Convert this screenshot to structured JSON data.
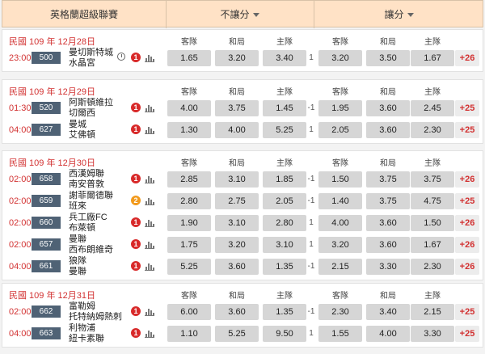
{
  "header": {
    "league": "英格蘭超級聯賽",
    "non_handicap": "不讓分",
    "handicap": "讓分"
  },
  "col_labels": [
    "客隊",
    "和局",
    "主隊",
    "客隊",
    "和局",
    "主隊"
  ],
  "colors": {
    "date_red": "#d23131",
    "code_bg": "#4f6275",
    "header_bg": "#ffe2c6",
    "badge_red": "#d82a2a",
    "badge_orange": "#f29a1c"
  },
  "sections": [
    {
      "date": "民國 109 年 12月28日",
      "matches": [
        {
          "time": "23:00",
          "code": "500",
          "away": "曼切斯特城",
          "home": "水晶宮",
          "clock": true,
          "badge": "1",
          "badge_color": "red",
          "o1": "1.65",
          "o2": "3.20",
          "o3": "3.40",
          "hcap": "1",
          "h1": "3.20",
          "h2": "3.50",
          "h3": "1.67",
          "more": "+26"
        }
      ]
    },
    {
      "date": "民國 109 年 12月29日",
      "matches": [
        {
          "time": "01:30",
          "code": "520",
          "away": "阿斯頓維拉",
          "home": "切爾西",
          "clock": false,
          "badge": "1",
          "badge_color": "red",
          "o1": "4.00",
          "o2": "3.75",
          "o3": "1.45",
          "hcap": "-1",
          "h1": "1.95",
          "h2": "3.60",
          "h3": "2.45",
          "more": "+25"
        },
        {
          "time": "04:00",
          "code": "627",
          "away": "曼城",
          "home": "艾佛頓",
          "clock": false,
          "badge": "1",
          "badge_color": "red",
          "o1": "1.30",
          "o2": "4.00",
          "o3": "5.25",
          "hcap": "1",
          "h1": "2.05",
          "h2": "3.60",
          "h3": "2.30",
          "more": "+25"
        }
      ]
    },
    {
      "date": "民國 109 年 12月30日",
      "matches": [
        {
          "time": "02:00",
          "code": "658",
          "away": "西漢姆聯",
          "home": "南安普敦",
          "clock": false,
          "badge": "1",
          "badge_color": "red",
          "o1": "2.85",
          "o2": "3.10",
          "o3": "1.85",
          "hcap": "-1",
          "h1": "1.50",
          "h2": "3.75",
          "h3": "3.75",
          "more": "+26"
        },
        {
          "time": "02:00",
          "code": "659",
          "away": "謝菲爾德聯",
          "home": "班來",
          "clock": false,
          "badge": "2",
          "badge_color": "orange",
          "o1": "2.80",
          "o2": "2.75",
          "o3": "2.05",
          "hcap": "-1",
          "h1": "1.40",
          "h2": "3.75",
          "h3": "4.75",
          "more": "+25"
        },
        {
          "time": "02:00",
          "code": "660",
          "away": "兵工廠FC",
          "home": "布萊頓",
          "clock": false,
          "badge": "1",
          "badge_color": "red",
          "o1": "1.90",
          "o2": "3.10",
          "o3": "2.80",
          "hcap": "1",
          "h1": "4.00",
          "h2": "3.60",
          "h3": "1.50",
          "more": "+26"
        },
        {
          "time": "02:00",
          "code": "657",
          "away": "曼聯",
          "home": "西布朗維奇",
          "clock": false,
          "badge": "1",
          "badge_color": "red",
          "o1": "1.75",
          "o2": "3.20",
          "o3": "3.10",
          "hcap": "1",
          "h1": "3.20",
          "h2": "3.60",
          "h3": "1.67",
          "more": "+26"
        },
        {
          "time": "04:00",
          "code": "661",
          "away": "狼隊",
          "home": "曼聯",
          "clock": false,
          "badge": "1",
          "badge_color": "red",
          "o1": "5.25",
          "o2": "3.60",
          "o3": "1.35",
          "hcap": "-1",
          "h1": "2.15",
          "h2": "3.30",
          "h3": "2.30",
          "more": "+26"
        }
      ]
    },
    {
      "date": "民國 109 年 12月31日",
      "matches": [
        {
          "time": "02:00",
          "code": "662",
          "away": "富勒姆",
          "home": "托特納姆熱刺",
          "clock": false,
          "badge": "1",
          "badge_color": "red",
          "o1": "6.00",
          "o2": "3.60",
          "o3": "1.35",
          "hcap": "-1",
          "h1": "2.30",
          "h2": "3.40",
          "h3": "2.15",
          "more": "+25"
        },
        {
          "time": "04:00",
          "code": "663",
          "away": "利物浦",
          "home": "紐卡素聯",
          "clock": false,
          "badge": "1",
          "badge_color": "red",
          "o1": "1.10",
          "o2": "5.25",
          "o3": "9.50",
          "hcap": "1",
          "h1": "1.55",
          "h2": "4.00",
          "h3": "3.30",
          "more": "+25"
        }
      ]
    }
  ]
}
